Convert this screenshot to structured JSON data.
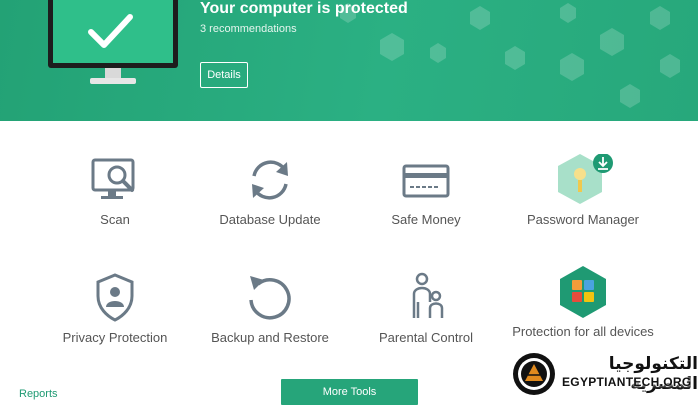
{
  "header": {
    "title": "Your computer is protected",
    "subtitle": "3 recommendations",
    "details_label": "Details"
  },
  "tiles": [
    {
      "label": "Scan",
      "icon": "scan-monitor-icon"
    },
    {
      "label": "Database Update",
      "icon": "refresh-icon"
    },
    {
      "label": "Safe Money",
      "icon": "credit-card-icon"
    },
    {
      "label": "Password Manager",
      "icon": "password-manager-icon"
    },
    {
      "label": "Privacy Protection",
      "icon": "privacy-shield-icon"
    },
    {
      "label": "Backup and Restore",
      "icon": "backup-restore-icon"
    },
    {
      "label": "Parental Control",
      "icon": "family-icon"
    },
    {
      "label": "Protection for all devices",
      "icon": "devices-protection-icon"
    }
  ],
  "footer": {
    "reports_label": "Reports",
    "more_tools_label": "More Tools"
  },
  "watermark": {
    "arabic": "التكنولوجيا المصرية",
    "english": "EGYPTIANTECH.ORG"
  },
  "colors": {
    "accent": "#26a57a",
    "icon_gray": "#6b7a87"
  }
}
